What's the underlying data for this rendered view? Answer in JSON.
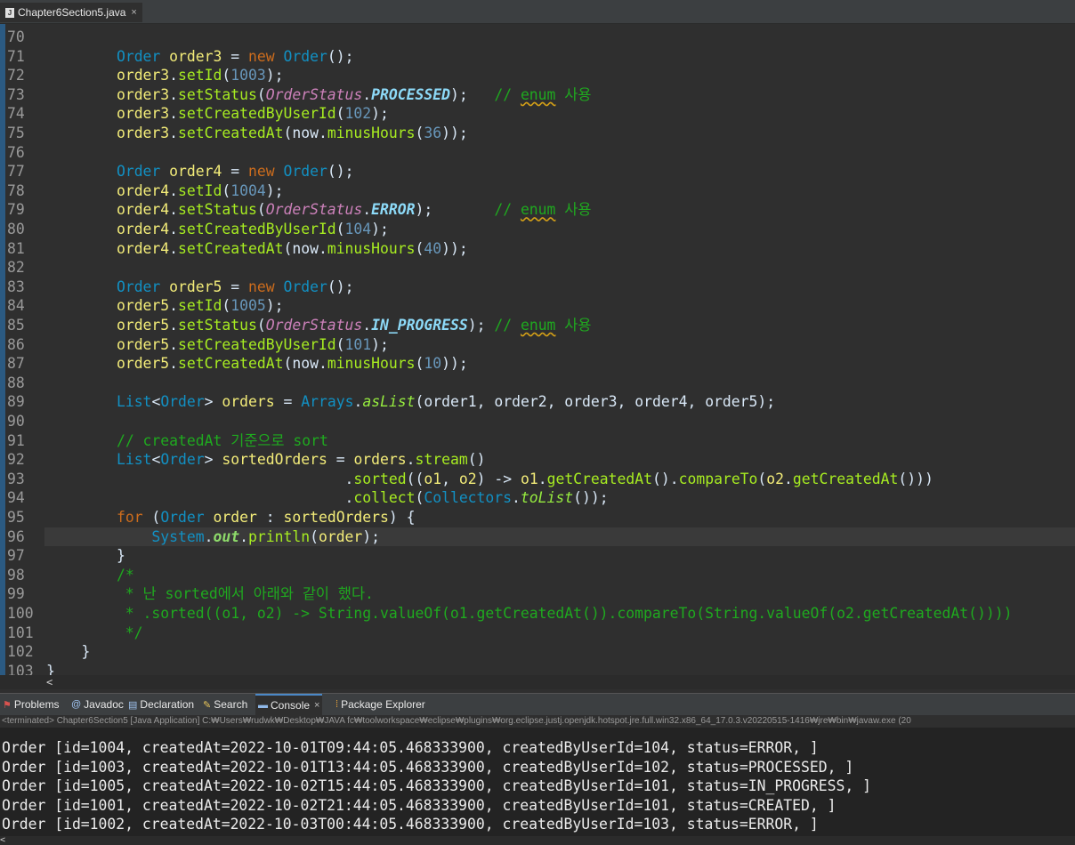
{
  "editor_tab": {
    "title": "Chapter6Section5.java",
    "close": "×"
  },
  "code": {
    "lines": [
      {
        "ln": "70",
        "src": ""
      },
      {
        "ln": "71",
        "src": "        <span class='type'>Order</span> <span class='var'>order3</span> = <span class='kw'>new</span> <span class='type'>Order</span>();"
      },
      {
        "ln": "72",
        "src": "        <span class='var'>order3</span>.<span class='meth'>setId</span>(<span class='num'>1003</span>);"
      },
      {
        "ln": "73",
        "src": "        <span class='var'>order3</span>.<span class='meth'>setStatus</span>(<span class='enumtype'>OrderStatus</span>.<span class='enumconst'>PROCESSED</span>);   <span class='cmt'>// <span class='sq'>enum</span> 사용</span>"
      },
      {
        "ln": "74",
        "src": "        <span class='var'>order3</span>.<span class='meth'>setCreatedByUserId</span>(<span class='num'>102</span>);"
      },
      {
        "ln": "75",
        "src": "        <span class='var'>order3</span>.<span class='meth'>setCreatedAt</span>(now.<span class='meth'>minusHours</span>(<span class='num'>36</span>));"
      },
      {
        "ln": "76",
        "src": ""
      },
      {
        "ln": "77",
        "src": "        <span class='type'>Order</span> <span class='var'>order4</span> = <span class='kw'>new</span> <span class='type'>Order</span>();"
      },
      {
        "ln": "78",
        "src": "        <span class='var'>order4</span>.<span class='meth'>setId</span>(<span class='num'>1004</span>);"
      },
      {
        "ln": "79",
        "src": "        <span class='var'>order4</span>.<span class='meth'>setStatus</span>(<span class='enumtype'>OrderStatus</span>.<span class='enumconst'>ERROR</span>);       <span class='cmt'>// <span class='sq'>enum</span> 사용</span>"
      },
      {
        "ln": "80",
        "src": "        <span class='var'>order4</span>.<span class='meth'>setCreatedByUserId</span>(<span class='num'>104</span>);"
      },
      {
        "ln": "81",
        "src": "        <span class='var'>order4</span>.<span class='meth'>setCreatedAt</span>(now.<span class='meth'>minusHours</span>(<span class='num'>40</span>));"
      },
      {
        "ln": "82",
        "src": ""
      },
      {
        "ln": "83",
        "src": "        <span class='type'>Order</span> <span class='var'>order5</span> = <span class='kw'>new</span> <span class='type'>Order</span>();"
      },
      {
        "ln": "84",
        "src": "        <span class='var'>order5</span>.<span class='meth'>setId</span>(<span class='num'>1005</span>);"
      },
      {
        "ln": "85",
        "src": "        <span class='var'>order5</span>.<span class='meth'>setStatus</span>(<span class='enumtype'>OrderStatus</span>.<span class='enumconst'>IN_PROGRESS</span>); <span class='cmt'>// <span class='sq'>enum</span> 사용</span>"
      },
      {
        "ln": "86",
        "src": "        <span class='var'>order5</span>.<span class='meth'>setCreatedByUserId</span>(<span class='num'>101</span>);"
      },
      {
        "ln": "87",
        "src": "        <span class='var'>order5</span>.<span class='meth'>setCreatedAt</span>(now.<span class='meth'>minusHours</span>(<span class='num'>10</span>));"
      },
      {
        "ln": "88",
        "src": ""
      },
      {
        "ln": "89",
        "src": "        <span class='type'>List</span>&lt;<span class='type'>Order</span>&gt; <span class='var'>orders</span> = <span class='type'>Arrays</span>.<span class='smeth'>asList</span>(order1, order2, order3, order4, order5);"
      },
      {
        "ln": "90",
        "src": ""
      },
      {
        "ln": "91",
        "src": "        <span class='cmt'>// createdAt 기준으로 sort</span>"
      },
      {
        "ln": "92",
        "src": "        <span class='type'>List</span>&lt;<span class='type'>Order</span>&gt; <span class='var'>sortedOrders</span> = <span class='var'>orders</span>.<span class='meth'>stream</span>()"
      },
      {
        "ln": "93",
        "src": "                                  .<span class='meth'>sorted</span>((<span class='var'>o1</span>, <span class='var'>o2</span>) -&gt; <span class='var'>o1</span>.<span class='meth'>getCreatedAt</span>().<span class='meth'>compareTo</span>(<span class='var'>o2</span>.<span class='meth'>getCreatedAt</span>()))"
      },
      {
        "ln": "94",
        "src": "                                  .<span class='meth'>collect</span>(<span class='type'>Collectors</span>.<span class='smeth'>toList</span>());"
      },
      {
        "ln": "95",
        "src": "        <span class='kw'>for</span> (<span class='type'>Order</span> <span class='var'>order</span> : <span class='var'>sortedOrders</span>) {"
      },
      {
        "ln": "96",
        "src": "            <span class='type'>System</span>.<span class='sfield fld'>out</span>.<span class='meth'>println</span>(<span class='var'>order</span>);",
        "current": true
      },
      {
        "ln": "97",
        "src": "        }"
      },
      {
        "ln": "98",
        "src": "        <span class='cmt'>/*</span>"
      },
      {
        "ln": "99",
        "src": "<span class='cmt'>         * 난 sorted에서 아래와 같이 했다.</span>"
      },
      {
        "ln": "100",
        "src": "<span class='cmt'>         * .sorted((o1, o2) -&gt; String.valueOf(o1.getCreatedAt()).compareTo(String.valueOf(o2.getCreatedAt())))</span>"
      },
      {
        "ln": "101",
        "src": "<span class='cmt'>         */</span>"
      },
      {
        "ln": "102",
        "src": "    }"
      },
      {
        "ln": "103",
        "src": "}"
      }
    ]
  },
  "views": {
    "tabs": [
      {
        "label": "Problems",
        "icon": "problems-icon",
        "glyph": "⚑",
        "color": "#d9534f"
      },
      {
        "label": "Javadoc",
        "icon": "javadoc-icon",
        "glyph": "@",
        "color": "#9fc3f0"
      },
      {
        "label": "Declaration",
        "icon": "declaration-icon",
        "glyph": "▤",
        "color": "#9fc3f0"
      },
      {
        "label": "Search",
        "icon": "search-icon",
        "glyph": "✎",
        "color": "#e8c65a"
      },
      {
        "label": "Console",
        "icon": "console-icon",
        "glyph": "▬",
        "color": "#8fb8e8",
        "active": true,
        "close": "×"
      },
      {
        "label": "Package Explorer",
        "icon": "package-explorer-icon",
        "glyph": "⁞",
        "color": "#e8a33a"
      }
    ],
    "console_status": "<terminated> Chapter6Section5 [Java Application] C:₩Users₩rudwk₩Desktop₩JAVA fc₩toolworkspace₩eclipse₩plugins₩org.eclipse.justj.openjdk.hotspot.jre.full.win32.x86_64_17.0.3.v20220515-1416₩jre₩bin₩javaw.exe  (20"
  },
  "console": {
    "lines": [
      "Order [id=1004, createdAt=2022-10-01T09:44:05.468333900, createdByUserId=104, status=ERROR, ]",
      "Order [id=1003, createdAt=2022-10-01T13:44:05.468333900, createdByUserId=102, status=PROCESSED, ]",
      "Order [id=1005, createdAt=2022-10-02T15:44:05.468333900, createdByUserId=101, status=IN_PROGRESS, ]",
      "Order [id=1001, createdAt=2022-10-02T21:44:05.468333900, createdByUserId=101, status=CREATED, ]",
      "Order [id=1002, createdAt=2022-10-03T00:44:05.468333900, createdByUserId=103, status=ERROR, ]"
    ]
  },
  "scroll": {
    "left_arrow": "<"
  }
}
